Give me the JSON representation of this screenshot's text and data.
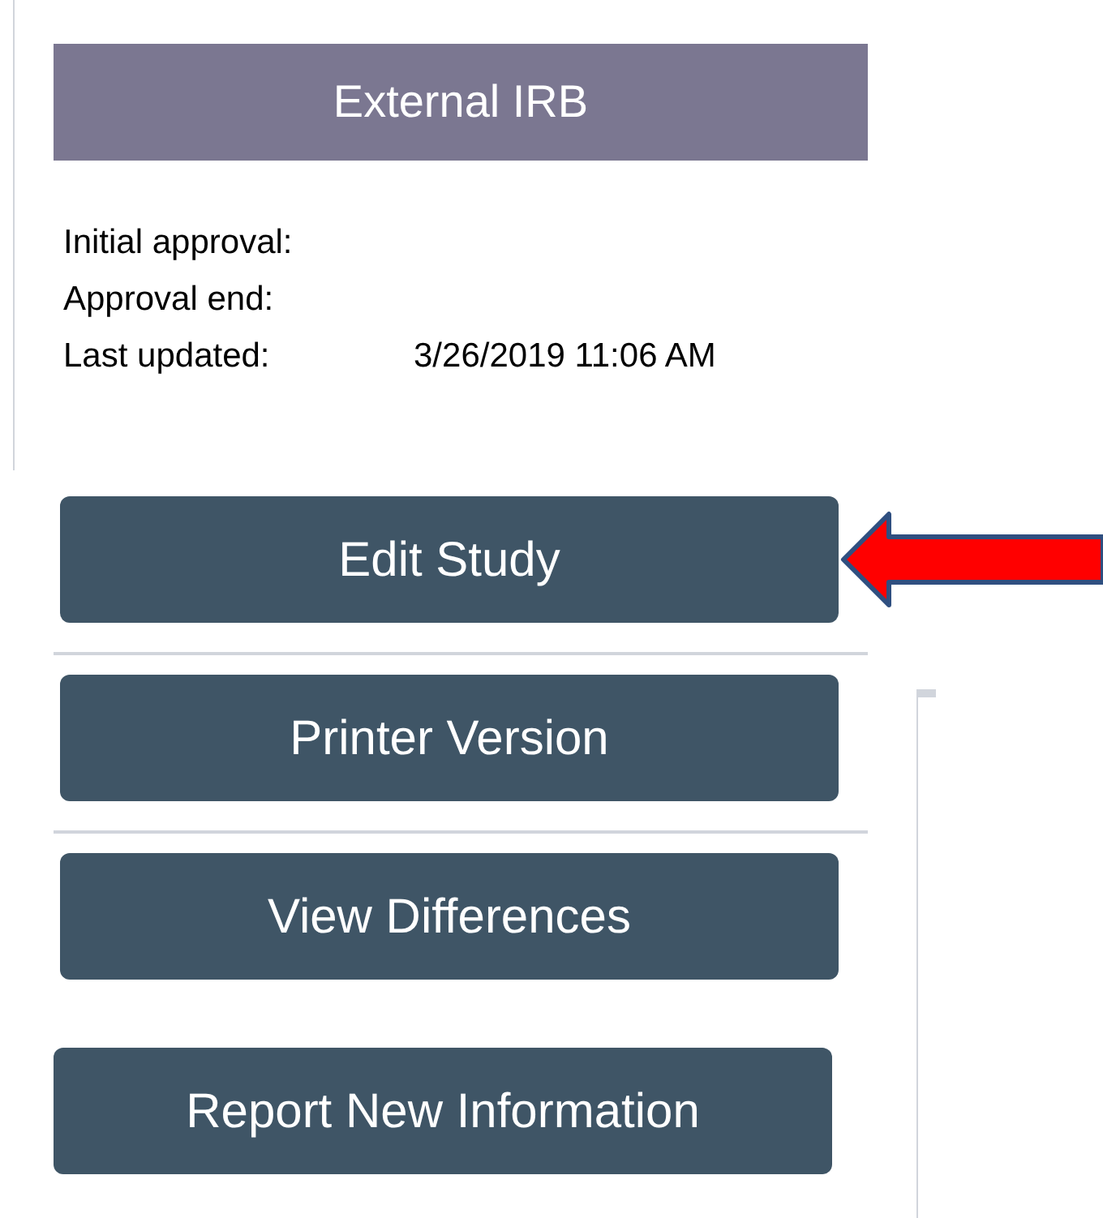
{
  "header": {
    "title": "External IRB"
  },
  "details": [
    {
      "label": "Initial approval:"
    },
    {
      "label": "Approval end:"
    },
    {
      "label": "Last updated:",
      "value": "3/26/2019 11:06 AM"
    }
  ],
  "actions": [
    {
      "label": "Edit Study",
      "highlighted": true,
      "divider_after": true
    },
    {
      "label": "Printer Version",
      "highlighted": false,
      "divider_after": true
    },
    {
      "label": "View Differences",
      "highlighted": false,
      "divider_after": false
    },
    {
      "label": "Report New Information",
      "highlighted": false,
      "divider_after": false
    }
  ]
}
